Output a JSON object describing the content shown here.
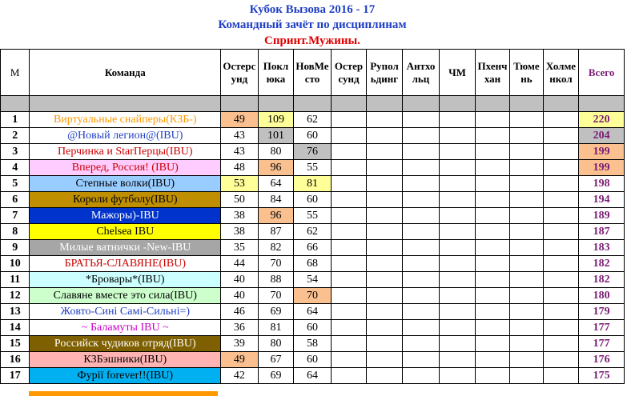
{
  "title": "Кубок Вызова 2016 - 17",
  "subtitle": "Командный зачёт по дисциплинам",
  "discipline": "Спринт.Мужины.",
  "headers": {
    "place": "М",
    "team": "Команда",
    "col1": "Остерсунд",
    "col2": "Поклюка",
    "col3": "НовМесто",
    "col4": "Остерсунд",
    "col5": "Рупольдинг",
    "col6": "Антхольц",
    "col7": "ЧМ",
    "col8": "Пхенчхан",
    "col9": "Тюмень",
    "col10": "Холменкол",
    "total": "Всего"
  },
  "rows": [
    {
      "place": "1",
      "team": "Виртуальные снайперы(КЗБ-)",
      "s1": "49",
      "s2": "109",
      "s3": "62",
      "total": "220"
    },
    {
      "place": "2",
      "team": "@Новый легион@(IBU)",
      "s1": "43",
      "s2": "101",
      "s3": "60",
      "total": "204"
    },
    {
      "place": "3",
      "team": "Перчинка и StarПерцы(IBU)",
      "s1": "43",
      "s2": "80",
      "s3": "76",
      "total": "199"
    },
    {
      "place": "4",
      "team": "Вперед, Россия! (IBU)",
      "s1": "48",
      "s2": "96",
      "s3": "55",
      "total": "199"
    },
    {
      "place": "5",
      "team": "Степные волки(IBU)",
      "s1": "53",
      "s2": "64",
      "s3": "81",
      "total": "198"
    },
    {
      "place": "6",
      "team": "Короли футболу(IBU)",
      "s1": "50",
      "s2": "84",
      "s3": "60",
      "total": "194"
    },
    {
      "place": "7",
      "team": "Мажоры)-IBU",
      "s1": "38",
      "s2": "96",
      "s3": "55",
      "total": "189"
    },
    {
      "place": "8",
      "team": "Chelsea IBU",
      "s1": "38",
      "s2": "87",
      "s3": "62",
      "total": "187"
    },
    {
      "place": "9",
      "team": "Милые ватнички -New-IBU",
      "s1": "35",
      "s2": "82",
      "s3": "66",
      "total": "183"
    },
    {
      "place": "10",
      "team": "БРАТЬЯ-СЛАВЯНЕ(IBU)",
      "s1": "44",
      "s2": "70",
      "s3": "68",
      "total": "182"
    },
    {
      "place": "11",
      "team": "*Бровары*(IBU)",
      "s1": "40",
      "s2": "88",
      "s3": "54",
      "total": "182"
    },
    {
      "place": "12",
      "team": "Славяне вместе это сила(IBU)",
      "s1": "40",
      "s2": "70",
      "s3": "70",
      "total": "180"
    },
    {
      "place": "13",
      "team": "Жовто-Сині Самі-Сильні=)",
      "s1": "46",
      "s2": "69",
      "s3": "64",
      "total": "179"
    },
    {
      "place": "14",
      "team": "~ Баламуты IBU ~",
      "s1": "36",
      "s2": "81",
      "s3": "60",
      "total": "177"
    },
    {
      "place": "15",
      "team": "Российск чудиков отряд(IBU)",
      "s1": "39",
      "s2": "80",
      "s3": "58",
      "total": "177"
    },
    {
      "place": "16",
      "team": "КЗБэшники(IBU)",
      "s1": "49",
      "s2": "67",
      "s3": "60",
      "total": "176"
    },
    {
      "place": "17",
      "team": "Фурії forever!!(IBU)",
      "s1": "42",
      "s2": "69",
      "s3": "64",
      "total": "175"
    }
  ],
  "colors": {
    "title": "#1f3fc4",
    "discipline": "#e00000",
    "total_text": "#7a1b74",
    "highlight_yellow": "#ffff99",
    "highlight_orange": "#fac090",
    "highlight_gray": "#c0c0c0",
    "team_backgrounds": [
      "#ffffff",
      "#ffffff",
      "#ffffff",
      "#ffccff",
      "#99ccff",
      "#bf8f00",
      "#0033cc",
      "#ffff00",
      "#a6a6a6",
      "#ffffff",
      "#ccffff",
      "#ccffcc",
      "#ffffff",
      "#ffffff",
      "#7f6000",
      "#ffb3b3",
      "#00b0f0"
    ],
    "team_text": [
      "#ff9900",
      "#1f3fc4",
      "#cc0000",
      "#cc0000",
      "#000000",
      "#000000",
      "#ffffff",
      "#000000",
      "#ffffff",
      "#cc0000",
      "#000000",
      "#000000",
      "#1f3fc4",
      "#cc00cc",
      "#ffffff",
      "#000000",
      "#000000"
    ]
  }
}
